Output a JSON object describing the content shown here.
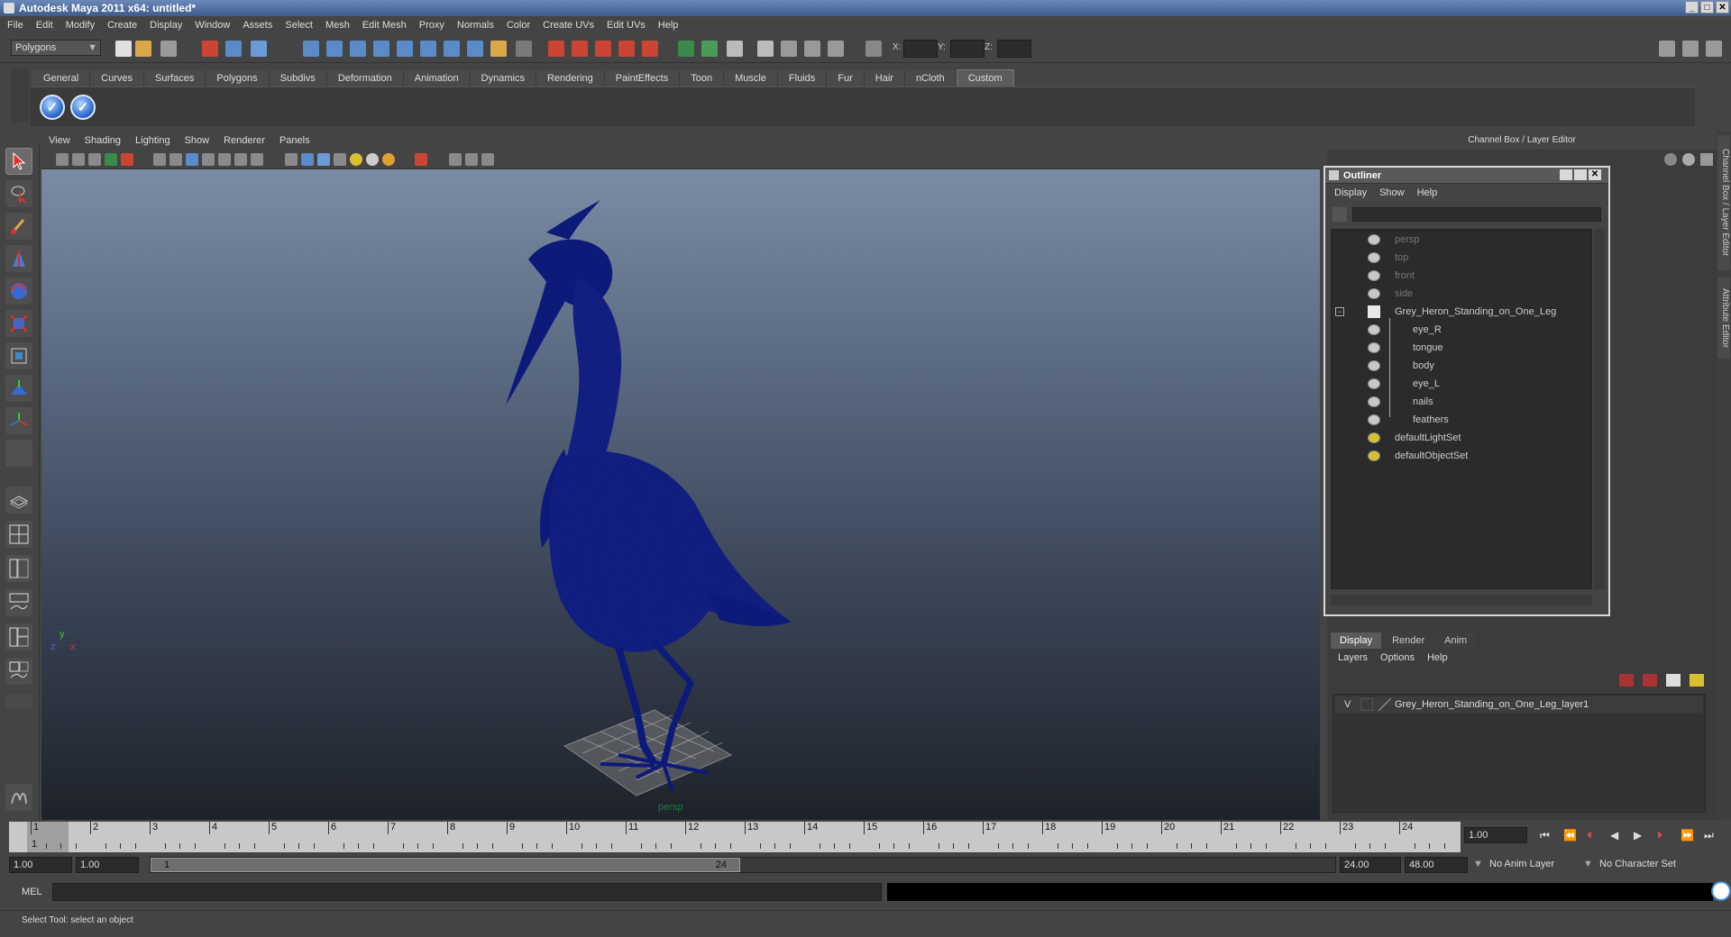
{
  "window": {
    "title": "Autodesk Maya 2011 x64: untitled*"
  },
  "menubar": [
    "File",
    "Edit",
    "Modify",
    "Create",
    "Display",
    "Window",
    "Assets",
    "Select",
    "Mesh",
    "Edit Mesh",
    "Proxy",
    "Normals",
    "Color",
    "Create UVs",
    "Edit UVs",
    "Help"
  ],
  "statusline": {
    "mode": "Polygons",
    "x_label": "X:",
    "y_label": "Y:",
    "z_label": "Z:"
  },
  "shelf": {
    "tabs": [
      "General",
      "Curves",
      "Surfaces",
      "Polygons",
      "Subdivs",
      "Deformation",
      "Animation",
      "Dynamics",
      "Rendering",
      "PaintEffects",
      "Toon",
      "Muscle",
      "Fluids",
      "Fur",
      "Hair",
      "nCloth",
      "Custom"
    ],
    "active_tab": "Custom"
  },
  "viewport": {
    "menu": [
      "View",
      "Shading",
      "Lighting",
      "Show",
      "Renderer",
      "Panels"
    ],
    "camera_label": "persp",
    "axis_y": "y",
    "axis_x": "x",
    "axis_z": "z"
  },
  "right_panel": {
    "header": "Channel Box / Layer Editor",
    "side_tab_1": "Channel Box / Layer Editor",
    "side_tab_2": "Attribute Editor"
  },
  "outliner": {
    "title": "Outliner",
    "menu": [
      "Display",
      "Show",
      "Help"
    ],
    "items": [
      {
        "label": "persp",
        "dim": true,
        "indent": 0
      },
      {
        "label": "top",
        "dim": true,
        "indent": 0
      },
      {
        "label": "front",
        "dim": true,
        "indent": 0
      },
      {
        "label": "side",
        "dim": true,
        "indent": 0
      },
      {
        "label": "Grey_Heron_Standing_on_One_Leg",
        "dim": false,
        "indent": 0
      },
      {
        "label": "eye_R",
        "dim": false,
        "indent": 1
      },
      {
        "label": "tongue",
        "dim": false,
        "indent": 1
      },
      {
        "label": "body",
        "dim": false,
        "indent": 1
      },
      {
        "label": "eye_L",
        "dim": false,
        "indent": 1
      },
      {
        "label": "nails",
        "dim": false,
        "indent": 1
      },
      {
        "label": "feathers",
        "dim": false,
        "indent": 1
      },
      {
        "label": "defaultLightSet",
        "dim": false,
        "indent": 0
      },
      {
        "label": "defaultObjectSet",
        "dim": false,
        "indent": 0
      }
    ]
  },
  "layer_editor": {
    "tabs": [
      "Display",
      "Render",
      "Anim"
    ],
    "active_tab": "Display",
    "menu": [
      "Layers",
      "Options",
      "Help"
    ],
    "layers": [
      {
        "visible": "V",
        "name": "Grey_Heron_Standing_on_One_Leg_layer1"
      }
    ]
  },
  "timeline": {
    "ticks": [
      "1",
      "2",
      "3",
      "4",
      "5",
      "6",
      "7",
      "8",
      "9",
      "10",
      "11",
      "12",
      "13",
      "14",
      "15",
      "16",
      "17",
      "18",
      "19",
      "20",
      "21",
      "22",
      "23",
      "24"
    ],
    "current_frame_marker": "1",
    "current_time": "1.00"
  },
  "range": {
    "start_time": "1.00",
    "playback_start": "1.00",
    "range_start": "1",
    "range_end": "24",
    "playback_end": "24.00",
    "end_time": "48.00",
    "anim_layer": "No Anim Layer",
    "character_set": "No Character Set"
  },
  "command_line": {
    "label": "MEL"
  },
  "help_line": {
    "text": "Select Tool: select an object"
  },
  "colors": {
    "mesh": "#0d1a7a",
    "viewport_top": "#7b8ba3",
    "viewport_bottom": "#1e222a",
    "camera_label": "#1e7a3a"
  }
}
